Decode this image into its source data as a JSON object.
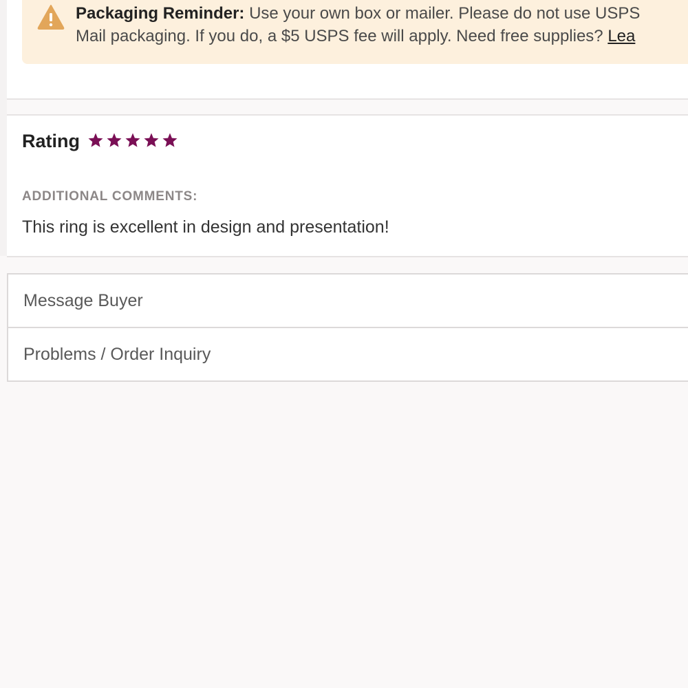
{
  "banner": {
    "icon": "warning-triangle-icon",
    "icon_color": "#e2a65a",
    "background": "#fdf0dd",
    "title": "Packaging Reminder:",
    "line1": "Use your own box or mailer. Please do not use USPS",
    "line2": "Mail packaging. If you do, a $5 USPS fee will apply. Need free supplies?",
    "link_label": "Lea"
  },
  "review": {
    "rating_label": "Rating",
    "rating_stars": 5,
    "rating_max": 5,
    "star_icon": "star-icon",
    "star_color": "#7a0f55",
    "comments_label": "ADDITIONAL COMMENTS:",
    "comments_text": "This ring is excellent in design and presentation!"
  },
  "actions": {
    "message_buyer": "Message Buyer",
    "problems_inquiry": "Problems / Order Inquiry"
  }
}
